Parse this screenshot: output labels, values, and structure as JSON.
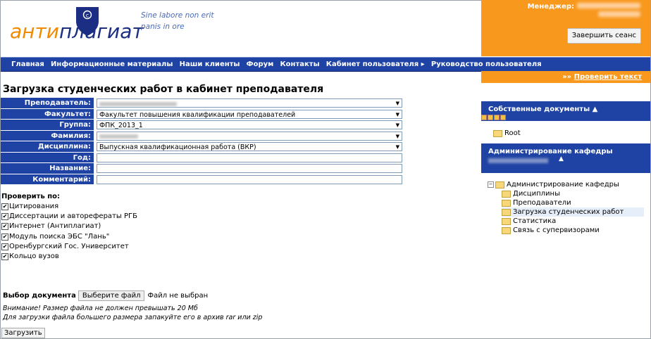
{
  "header": {
    "logo_part1": "анти",
    "logo_part2": "плагиат",
    "slogan_line1": "Sine labore non erit",
    "slogan_line2": "panis in ore",
    "manager_label": "Менеджер:",
    "end_session": "Завершить сеанс"
  },
  "nav": [
    "Главная",
    "Информационные материалы",
    "Наши клиенты",
    "Форум",
    "Контакты",
    "Кабинет пользователя ▸",
    "Руководство пользователя"
  ],
  "check_text_link": "Проверить текст",
  "page_title": "Загрузка студенческих работ в кабинет преподавателя",
  "form": {
    "teacher_label": "Преподаватель:",
    "faculty_label": "Факультет:",
    "faculty_value": "Факультет повышения квалификации преподавателей",
    "group_label": "Группа:",
    "group_value": "ФПК_2013_1",
    "surname_label": "Фамилия:",
    "discipline_label": "Дисциплина:",
    "discipline_value": "Выпускная квалификационная работа (ВКР)",
    "year_label": "Год:",
    "name_label": "Название:",
    "comment_label": "Комментарий:"
  },
  "check_title": "Проверить по:",
  "check_items": [
    "Цитирования",
    "Диссертации и авторефераты РГБ",
    "Интернет (Антиплагиат)",
    "Модуль поиска ЭБС \"Лань\"",
    "Оренбургский Гос. Университет",
    "Кольцо вузов"
  ],
  "document": {
    "label": "Выбор документа",
    "choose_btn": "Выберите файл",
    "no_file": "Файл не выбран",
    "warn1": "Внимание! Размер файла не должен превышать 20 Мб",
    "warn2": "Для загрузки файла большего размера запакуйте его в архив rar или zip",
    "upload_btn": "Загрузить"
  },
  "sidebar": {
    "own_docs": "Собственные документы",
    "root": "Root",
    "admin_title": "Администрирование кафедры",
    "admin_root": "Администрирование кафедры",
    "items": [
      "Дисциплины",
      "Преподаватели",
      "Загрузка студенческих работ",
      "Статистика",
      "Связь с супервизорами"
    ]
  },
  "colors": {
    "orange": "#f8981d",
    "navy": "#1f43a4"
  }
}
